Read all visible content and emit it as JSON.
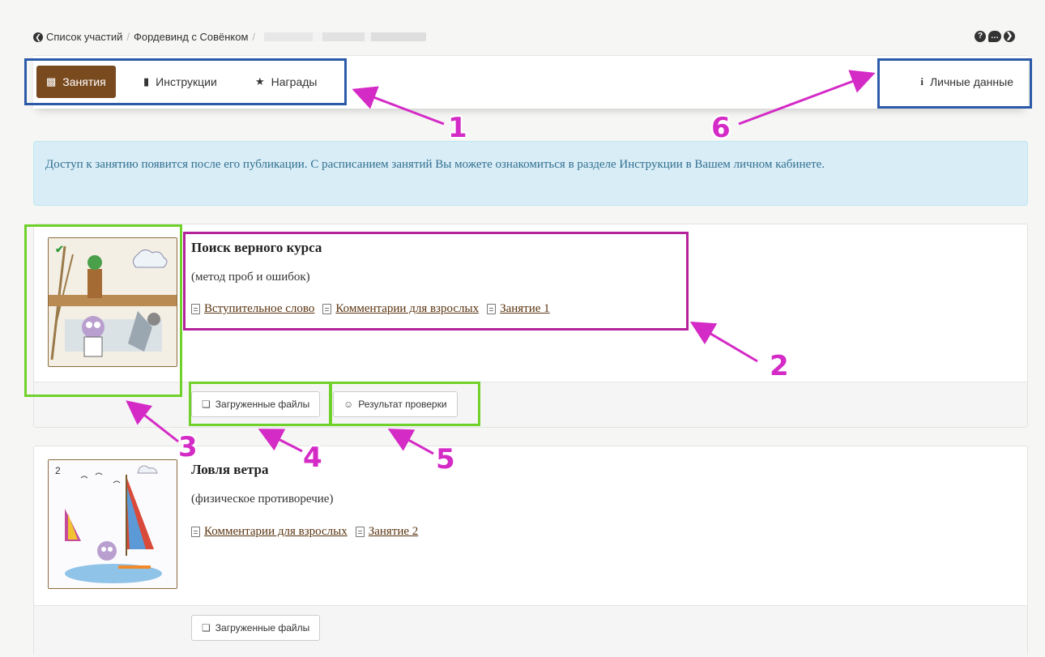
{
  "breadcrumb": {
    "back": "Список участий",
    "course": "Фордевинд с Совёнком"
  },
  "nav": {
    "lessons": "Занятия",
    "instructions": "Инструкции",
    "awards": "Награды",
    "personal": "Личные данные"
  },
  "alert": {
    "text": "Доступ к занятию появится после его публикации. С расписанием занятий Вы можете ознакомиться в разделе Инструкции в Вашем личном кабинете."
  },
  "lessons": [
    {
      "title": "Поиск верного курса",
      "subtitle": "(метод проб и ошибок)",
      "links": [
        "Вступительное слово",
        "Комментарии для взрослых",
        "Занятие 1"
      ],
      "buttons": [
        "Загруженные файлы",
        "Результат проверки"
      ],
      "status": "✔"
    },
    {
      "number": "2",
      "title": "Ловля ветра",
      "subtitle": "(физическое противоречие)",
      "links": [
        "Комментарии для взрослых",
        "Занятие 2"
      ],
      "buttons": [
        "Загруженные файлы"
      ]
    }
  ],
  "annotations": [
    "1",
    "2",
    "3",
    "4",
    "5",
    "6"
  ],
  "colors": {
    "brand": "#7a4a1f",
    "annotation_blue": "#2b5aa8",
    "annotation_green": "#6fd12a",
    "annotation_pink": "#b4239c",
    "arrow": "#d42ac6",
    "alert_bg": "#d9edf7"
  }
}
